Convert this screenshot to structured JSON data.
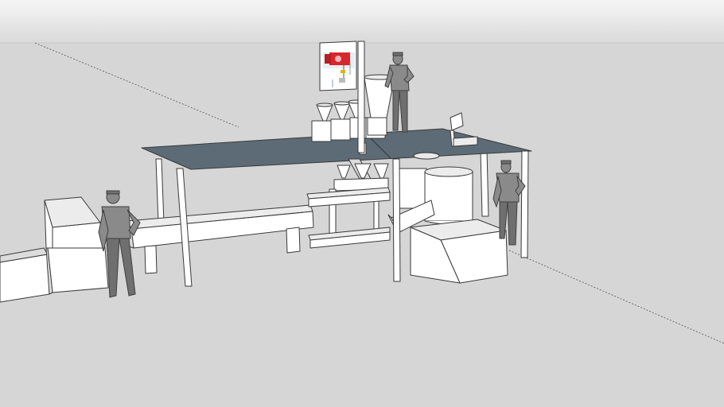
{
  "scene": {
    "sky_top": "#f6f6f6",
    "sky_bottom": "#d9d9d9",
    "ground": "#d6d6d6",
    "platform_color": "#5d6b76",
    "hoist_color": "#d7262c",
    "figure_color": "#8a8a8a"
  },
  "icons": {
    "hoist_sign": "hoist-icon"
  }
}
